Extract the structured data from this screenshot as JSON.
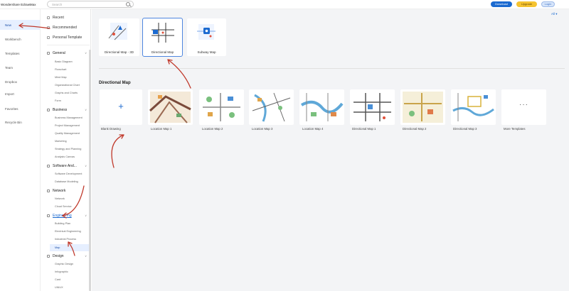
{
  "app": {
    "brand": "Wondershare EdrawMax"
  },
  "search": {
    "placeholder": "Search"
  },
  "header_buttons": {
    "download": "Download",
    "upgrade": "Upgrade",
    "login": "Login"
  },
  "rail": [
    {
      "label": "New",
      "active": true
    },
    {
      "label": "Workbench"
    },
    {
      "label": "Templates"
    },
    {
      "label": "Team"
    },
    {
      "label": "Dropbox"
    },
    {
      "label": "Import"
    },
    {
      "label": "Favorites"
    },
    {
      "label": "Recycle Bin"
    }
  ],
  "cats_top": [
    "Recent",
    "Recommended",
    "Personal Template"
  ],
  "categories": {
    "general": {
      "label": "General",
      "items": [
        "Basic Diagram",
        "Flowchart",
        "Mind Map",
        "Organizational Chart",
        "Graphs and Charts",
        "Form"
      ]
    },
    "business": {
      "label": "Business",
      "items": [
        "Business Management",
        "Project Management",
        "Quality Management",
        "Marketing",
        "Strategy and Planning",
        "Analysis Canvas"
      ]
    },
    "software": {
      "label": "Software And...",
      "items": [
        "Software Development",
        "Database Modeling"
      ]
    },
    "network": {
      "label": "Network",
      "items": [
        "Network",
        "Cloud Service"
      ]
    },
    "engineering": {
      "label": "Engineering",
      "items": [
        "Building Plan",
        "Electrical Engineering",
        "Industrial Process",
        "Map"
      ]
    },
    "design": {
      "label": "Design",
      "items": [
        "Graphic Design",
        "Infographic",
        "Card",
        "UI&UX"
      ]
    }
  },
  "main": {
    "all_filter": "All",
    "top_templates": [
      "Directional Map - 3D",
      "Directional Map",
      "Subway Map"
    ],
    "section_title": "Directional Map",
    "thumbnails": [
      "Blank Drawing",
      "Location Map 1",
      "Location Map 2",
      "Location Map 3",
      "Location Map 4",
      "Directional Map 1",
      "Directional Map 2",
      "Directional Map 3",
      "More Templates"
    ]
  },
  "colors": {
    "accent": "#1b6ad0",
    "selected_bg": "#e6efff",
    "annotation": "#c0392b"
  }
}
